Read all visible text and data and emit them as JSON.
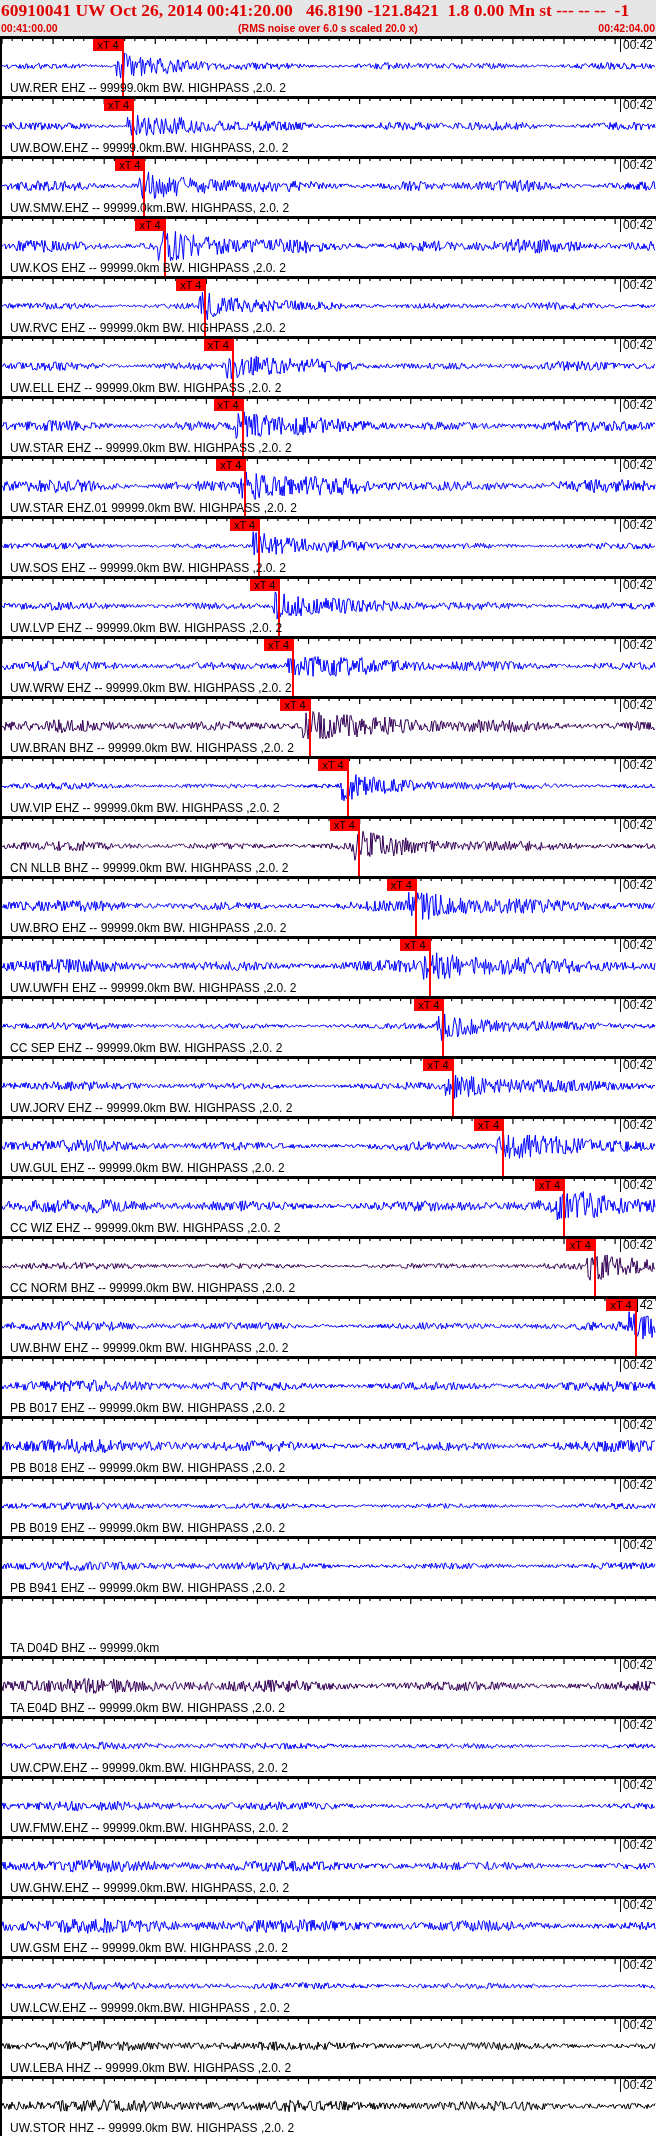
{
  "header": {
    "title": "60910041 UW Oct 26, 2014 00:41:20.00   46.8190 -121.8421  1.8 0.00 Mn st --- -- --  -1",
    "start_time": "00:41:00.00",
    "note": "(RMS noise over 6.0 s scaled 20.0 x)",
    "end_time": "00:42:04.00"
  },
  "traces": [
    {
      "label": "UW.RER EHZ -- 99999.0km BW. HIGHPASS ,2.0. 2",
      "kind": "waveform",
      "color": "#0000ff",
      "time_mark": "00:42",
      "pick": {
        "label": "xT 4",
        "level": 0.187
      }
    },
    {
      "label": "UW.BOW.EHZ -- 99999.0km.BW. HIGHPASS, 2.0. 2",
      "kind": "waveform",
      "color": "#0000ff",
      "time_mark": "00:42",
      "pick": {
        "label": "xT 4",
        "level": 0.203
      }
    },
    {
      "label": "UW.SMW.EHZ -- 99999.0km.BW. HIGHPASS, 2.0. 2",
      "kind": "waveform",
      "color": "#0000ff",
      "time_mark": "00:42",
      "pick": {
        "label": "xT 4",
        "level": 0.22
      }
    },
    {
      "label": "UW.KOS EHZ -- 99999.0km BW. HIGHPASS ,2.0. 2",
      "kind": "waveform",
      "color": "#0000ff",
      "time_mark": "00:42",
      "pick": {
        "label": "xT 4",
        "level": 0.251
      }
    },
    {
      "label": "UW.RVC EHZ -- 99999.0km BW. HIGHPASS ,2.0. 2",
      "kind": "waveform",
      "color": "#0000ff",
      "time_mark": "00:42",
      "pick": {
        "label": "xT 4",
        "level": 0.313
      }
    },
    {
      "label": "UW.ELL EHZ -- 99999.0km BW. HIGHPASS ,2.0. 2",
      "kind": "waveform",
      "color": "#0000ff",
      "time_mark": "00:42",
      "pick": {
        "label": "xT 4",
        "level": 0.355
      }
    },
    {
      "label": "UW.STAR EHZ -- 99999.0km BW. HIGHPASS ,2.0. 2",
      "kind": "waveform",
      "color": "#0000ff",
      "time_mark": "00:42",
      "pick": {
        "label": "xT 4",
        "level": 0.37
      }
    },
    {
      "label": "UW.STAR EHZ.01 99999.0km BW. HIGHPASS ,2.0. 2",
      "kind": "waveform",
      "color": "#0000ff",
      "time_mark": "00:42",
      "pick": {
        "label": "xT 4",
        "level": 0.374
      }
    },
    {
      "label": "UW.SOS EHZ -- 99999.0km BW. HIGHPASS ,2.0. 2",
      "kind": "waveform",
      "color": "#0000ff",
      "time_mark": "00:42",
      "pick": {
        "label": "xT 4",
        "level": 0.395
      }
    },
    {
      "label": "UW.LVP EHZ -- 99999.0km BW. HIGHPASS ,2.0. 2",
      "kind": "waveform",
      "color": "#0000ff",
      "time_mark": "00:42",
      "pick": {
        "label": "xT 4",
        "level": 0.426
      }
    },
    {
      "label": "UW.WRW EHZ -- 99999.0km BW. HIGHPASS ,2.0. 2",
      "kind": "waveform",
      "color": "#0000ff",
      "time_mark": "00:42",
      "pick": {
        "label": "xT 4",
        "level": 0.447
      }
    },
    {
      "label": "UW.BRAN BHZ -- 99999.0km BW. HIGHPASS ,2.0. 2",
      "kind": "waveform",
      "color": "#330055",
      "time_mark": "00:42",
      "pick": {
        "label": "xT 4",
        "level": 0.472
      }
    },
    {
      "label": "UW.VIP EHZ -- 99999.0km BW. HIGHPASS ,2.0. 2",
      "kind": "waveform",
      "color": "#0000ff",
      "time_mark": "00:42",
      "pick": {
        "label": "xT 4",
        "level": 0.53
      }
    },
    {
      "label": "CN NLLB BHZ -- 99999.0km BW. HIGHPASS ,2.0. 2",
      "kind": "waveform",
      "color": "#330055",
      "time_mark": "00:42",
      "pick": {
        "label": "xT 4",
        "level": 0.547
      }
    },
    {
      "label": "UW.BRO EHZ -- 99999.0km BW. HIGHPASS ,2.0. 2",
      "kind": "waveform",
      "color": "#0000ff",
      "time_mark": "00:42",
      "pick": {
        "label": "xT 4",
        "level": 0.634
      }
    },
    {
      "label": "UW.UWFH EHZ -- 99999.0km BW. HIGHPASS ,2.0. 2",
      "kind": "waveform",
      "color": "#0000ff",
      "time_mark": "00:42",
      "pick": {
        "label": "xT 4",
        "level": 0.655
      }
    },
    {
      "label": "CC SEP EHZ -- 99999.0km BW. HIGHPASS ,2.0. 2",
      "kind": "waveform",
      "color": "#0000ff",
      "time_mark": "00:42",
      "pick": {
        "label": "xT 4",
        "level": 0.676
      }
    },
    {
      "label": "UW.JORV EHZ -- 99999.0km BW. HIGHPASS ,2.0. 2",
      "kind": "waveform",
      "color": "#0000ff",
      "time_mark": "00:42",
      "pick": {
        "label": "xT 4",
        "level": 0.69
      }
    },
    {
      "label": "UW.GUL EHZ -- 99999.0km BW. HIGHPASS ,2.0. 2",
      "kind": "waveform",
      "color": "#0000ff",
      "time_mark": "00:42",
      "pick": {
        "label": "xT 4",
        "level": 0.767
      }
    },
    {
      "label": "CC WIZ EHZ -- 99999.0km BW. HIGHPASS ,2.0. 2",
      "kind": "waveform",
      "color": "#0000ff",
      "time_mark": "00:42",
      "pick": {
        "label": "xT 4",
        "level": 0.86
      }
    },
    {
      "label": "CC NORM BHZ -- 99999.0km BW. HIGHPASS ,2.0. 2",
      "kind": "waveform",
      "color": "#330055",
      "time_mark": "00:42",
      "pick": {
        "label": "xT 4",
        "level": 0.907
      }
    },
    {
      "label": "UW.BHW EHZ -- 99999.0km BW. HIGHPASS ,2.0. 2",
      "kind": "waveform",
      "color": "#0000ff",
      "time_mark": "42",
      "pick": {
        "label": "xT 4",
        "level": 0.969
      }
    },
    {
      "label": "PB B017 EHZ -- 99999.0km BW. HIGHPASS ,2.0. 2",
      "kind": "waveform",
      "color": "#0000ff",
      "time_mark": "00:42"
    },
    {
      "label": "PB B018 EHZ -- 99999.0km BW. HIGHPASS ,2.0. 2",
      "kind": "waveform",
      "color": "#0000ff",
      "time_mark": "00:42"
    },
    {
      "label": "PB B019 EHZ -- 99999.0km BW. HIGHPASS ,2.0. 2",
      "kind": "waveform",
      "color": "#0000ff",
      "time_mark": "00:42"
    },
    {
      "label": "PB B941 EHZ -- 99999.0km BW. HIGHPASS ,2.0. 2",
      "kind": "waveform",
      "color": "#0000ff",
      "time_mark": "00:42"
    },
    {
      "label": "TA D04D BHZ -- 99999.0km",
      "kind": "blank"
    },
    {
      "label": "TA E04D BHZ -- 99999.0km BW. HIGHPASS ,2.0. 2",
      "kind": "waveform",
      "color": "#330055",
      "time_mark": "00:42"
    },
    {
      "label": "UW.CPW.EHZ -- 99999.0km.BW. HIGHPASS, 2.0. 2",
      "kind": "waveform",
      "color": "#0000ff",
      "time_mark": "00:42"
    },
    {
      "label": "UW.FMW.EHZ -- 99999.0km.BW. HIGHPASS, 2.0. 2",
      "kind": "waveform",
      "color": "#0000ff",
      "time_mark": "00:42"
    },
    {
      "label": "UW.GHW.EHZ -- 99999.0km.BW. HIGHPASS, 2.0. 2",
      "kind": "waveform",
      "color": "#0000ff",
      "time_mark": "00:42"
    },
    {
      "label": "UW.GSM EHZ -- 99999.0km BW. HIGHPASS ,2.0. 2",
      "kind": "waveform",
      "color": "#0000ff",
      "time_mark": "00:42"
    },
    {
      "label": "UW.LCW.EHZ -- 99999.0km.BW. HIGHPASS , 2.0. 2",
      "kind": "waveform",
      "color": "#0000ff",
      "time_mark": "00:42"
    },
    {
      "label": "UW.LEBA HHZ -- 99999.0km BW. HIGHPASS ,2.0. 2",
      "kind": "waveform",
      "color": "#000000",
      "time_mark": "00:42"
    },
    {
      "label": "UW.STOR HHZ -- 99999.0km BW. HIGHPASS ,2.0. 2",
      "kind": "waveform",
      "color": "#000000",
      "time_mark": "00:42"
    }
  ]
}
